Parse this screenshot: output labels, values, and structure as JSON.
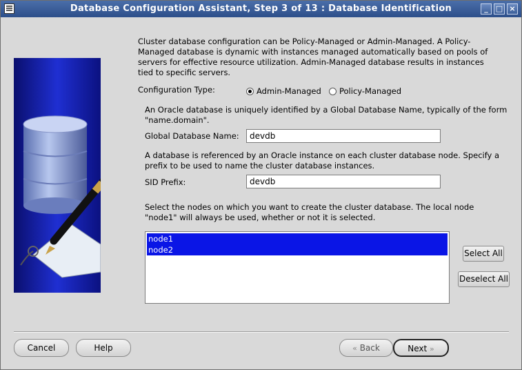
{
  "window": {
    "title": "Database Configuration Assistant, Step 3 of 13 : Database Identification",
    "controls": {
      "minimize": "_",
      "maximize": "□",
      "close": "×"
    }
  },
  "intro_text": "Cluster database configuration can be Policy-Managed or Admin-Managed. A Policy-Managed database is dynamic with instances managed automatically based on pools of servers for effective resource utilization. Admin-Managed database results in instances tied to specific servers.",
  "configuration_type": {
    "label": "Configuration Type:",
    "options": [
      {
        "label": "Admin-Managed",
        "selected": true
      },
      {
        "label": "Policy-Managed",
        "selected": false
      }
    ]
  },
  "global_db": {
    "description": "An Oracle database is uniquely identified by a Global Database Name, typically of the form \"name.domain\".",
    "label": "Global Database Name:",
    "value": "devdb"
  },
  "sid": {
    "description": "A database is referenced by an Oracle instance on each cluster database node. Specify a prefix to be used to name the cluster database instances.",
    "label": "SID Prefix:",
    "value": "devdb"
  },
  "nodes": {
    "description": "Select the nodes on which you want to create the cluster database. The local node \"node1\" will always be used, whether or not it is selected.",
    "items": [
      {
        "label": "node1",
        "selected": true
      },
      {
        "label": "node2",
        "selected": true
      }
    ],
    "select_all_label": "Select All",
    "deselect_all_label": "Deselect All"
  },
  "footer": {
    "cancel_label": "Cancel",
    "help_label": "Help",
    "back_label": "Back",
    "next_label": "Next"
  },
  "colors": {
    "titlebar": "#3a5e9a",
    "selection": "#0a15e6",
    "window_bg": "#d9d9d9"
  }
}
